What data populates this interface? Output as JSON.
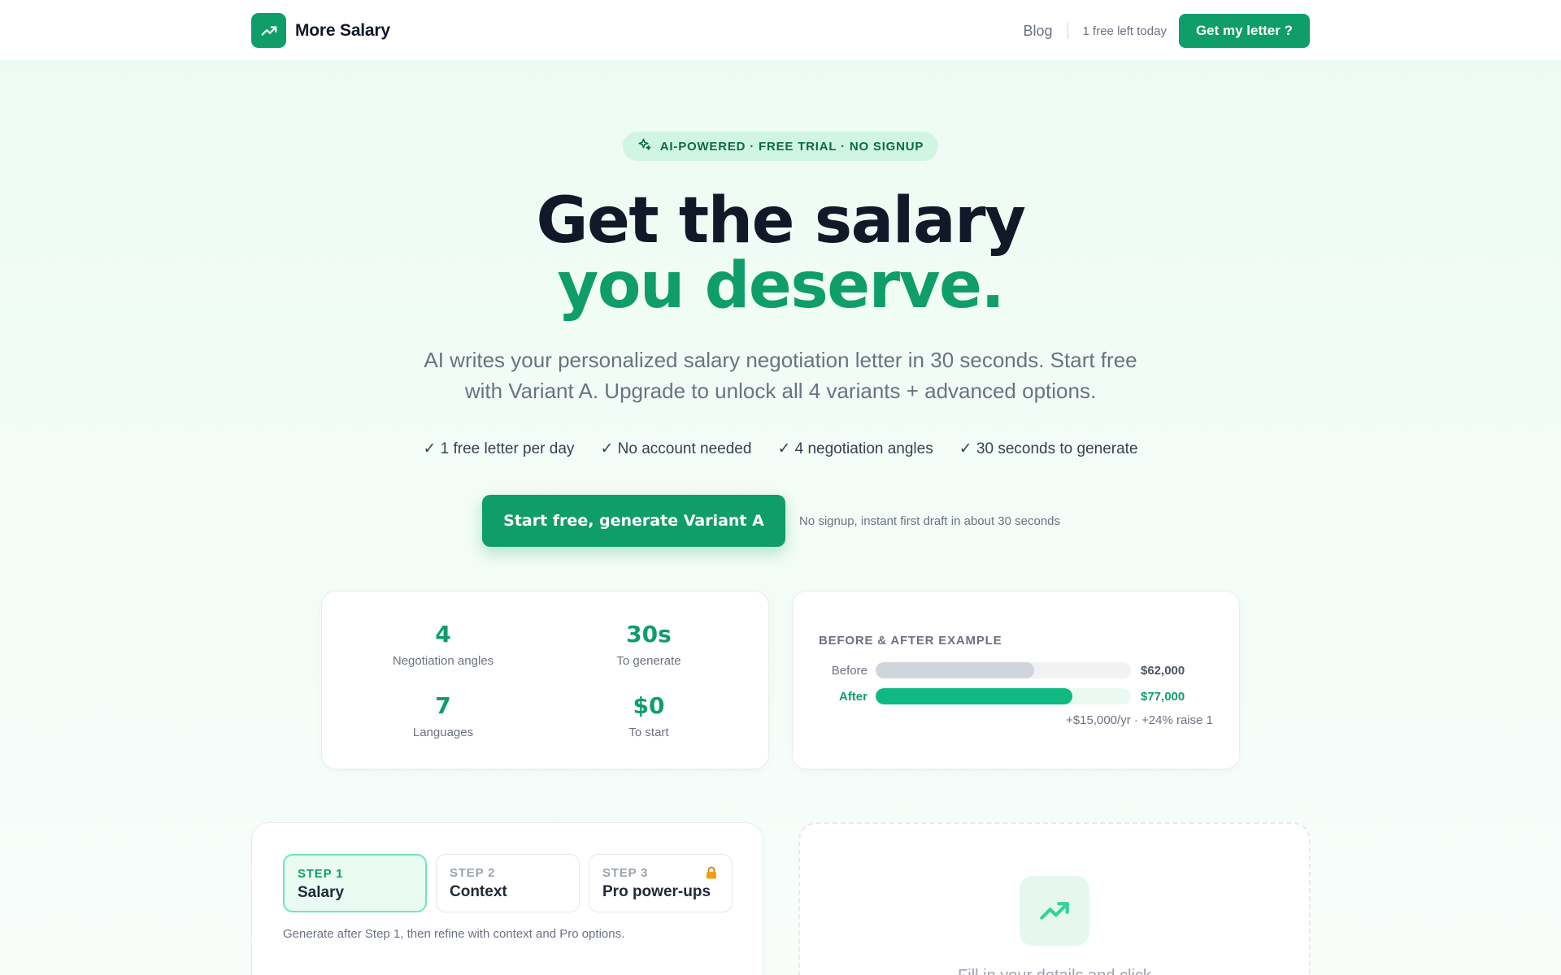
{
  "header": {
    "brand": "More Salary",
    "nav_blog": "Blog",
    "free_left": "1 free left today",
    "cta": "Get my letter ?"
  },
  "hero": {
    "badge": "AI-POWERED · FREE TRIAL · NO SIGNUP",
    "title_line1": "Get the salary",
    "title_line2": "you deserve.",
    "subtitle": "AI writes your personalized salary negotiation letter in 30 seconds. Start free with Variant A. Upgrade to unlock all 4 variants + advanced options.",
    "features": [
      "✓ 1 free letter per day",
      "✓ No account needed",
      "✓ 4 negotiation angles",
      "✓ 30 seconds to generate"
    ],
    "cta": "Start free, generate Variant A",
    "cta_note": "No signup, instant first draft in about 30 seconds"
  },
  "stats": [
    {
      "value": "4",
      "label": "Negotiation angles"
    },
    {
      "value": "30s",
      "label": "To generate"
    },
    {
      "value": "7",
      "label": "Languages"
    },
    {
      "value": "$0",
      "label": "To start"
    }
  ],
  "example": {
    "title": "BEFORE & AFTER EXAMPLE",
    "before_label": "Before",
    "before_value": "$62,000",
    "before_fill": 0.62,
    "after_label": "After",
    "after_value": "$77,000",
    "after_fill": 0.77,
    "footnote": "+$15,000/yr · +24% raise 1"
  },
  "form": {
    "steps": [
      {
        "kicker": "STEP 1",
        "name": "Salary"
      },
      {
        "kicker": "STEP 2",
        "name": "Context"
      },
      {
        "kicker": "STEP 3",
        "name": "Pro power-ups"
      }
    ],
    "hint": "Generate after Step 1, then refine with context and Pro options."
  },
  "preview": {
    "text": "Fill in your details and click"
  },
  "colors": {
    "brand": "#0f9d6a",
    "accent_bar": "#10b981",
    "badge_bg": "#d1f5e3",
    "lock": "#f59e0b"
  }
}
